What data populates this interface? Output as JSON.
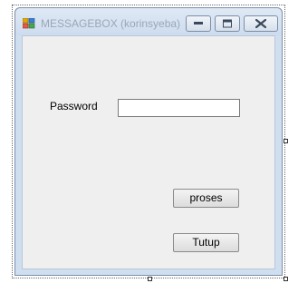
{
  "window": {
    "title": "MESSAGEBOX (korinsyeba)",
    "icons": {
      "app": "app-icon",
      "minimize": "minimize-icon",
      "maximize": "maximize-icon",
      "close": "close-icon"
    }
  },
  "form": {
    "password_label": "Password",
    "password_value": "",
    "proses_label": "proses",
    "tutup_label": "Tutup"
  }
}
